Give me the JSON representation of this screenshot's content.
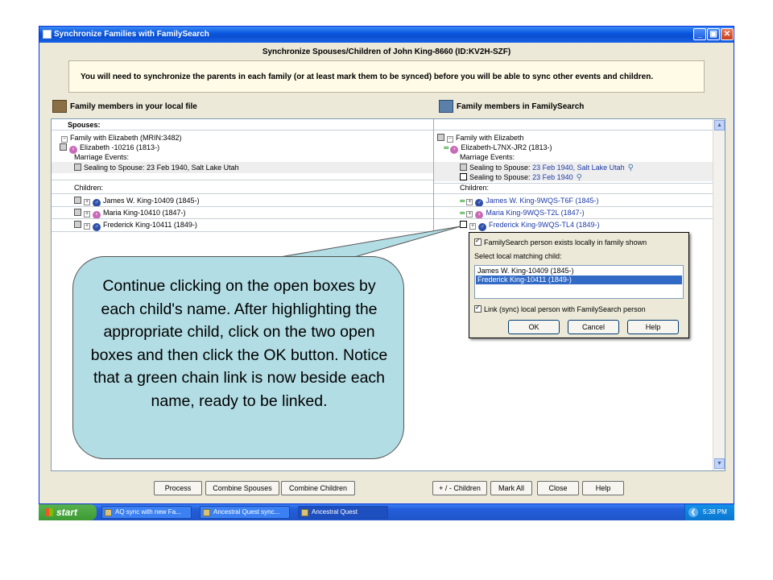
{
  "window": {
    "title": "Synchronize Families with FamilySearch",
    "dialog_title": "Synchronize Spouses/Children of John King-8660   (ID:KV2H-SZF)",
    "message": "You will need to synchronize the parents in each family (or at least mark them to be synced) before you will be able to sync other events and children."
  },
  "panes": {
    "local_header": "Family members in your local file",
    "fs_header": "Family members in FamilySearch",
    "spouses_label": "Spouses:"
  },
  "local": {
    "family": "Family with Elizabeth (MRIN:3482)",
    "spouse": "Elizabeth -10216 (1813-)",
    "marriage_label": "Marriage Events:",
    "sealing": "Sealing to Spouse: 23 Feb 1940, Salt Lake Utah",
    "children_label": "Children:",
    "children": [
      "James W. King-10409 (1845-)",
      "Maria King-10410 (1847-)",
      "Frederick King-10411 (1849-)"
    ]
  },
  "familysearch": {
    "family": "Family with Elizabeth",
    "spouse": "Elizabeth-L7NX-JR2 (1813-)",
    "marriage_label": "Marriage Events:",
    "sealing1_prefix": "Sealing to Spouse: ",
    "sealing1_value": "23 Feb 1940, Salt Lake Utah",
    "sealing2_prefix": "Sealing to Spouse: ",
    "sealing2_value": "23 Feb 1940",
    "children_label": "Children:",
    "children": [
      "James W. King-9WQS-T6F (1845-)",
      "Maria King-9WQS-T2L (1847-)",
      "Frederick King-9WQS-TL4 (1849-)"
    ]
  },
  "popup": {
    "exists_label": "FamilySearch person exists locally in family shown",
    "select_label": "Select local matching child:",
    "options": [
      "James W. King-10409 (1845-)",
      "Frederick King-10411 (1849-)"
    ],
    "selected_index": 1,
    "link_label": "Link (sync) local person with FamilySearch person",
    "ok": "OK",
    "cancel": "Cancel",
    "help": "Help"
  },
  "buttons": {
    "process": "Process",
    "combine_spouses": "Combine Spouses",
    "combine_children": "Combine Children",
    "plus_minus_children": "+ / - Children",
    "mark_all": "Mark All",
    "close": "Close",
    "help": "Help"
  },
  "taskbar": {
    "start": "start",
    "tasks": [
      "AQ sync with new Fa...",
      "Ancestral Quest sync...",
      "Ancestral Quest"
    ],
    "clock": "5:38 PM"
  },
  "callout": {
    "text": "Continue clicking on the open boxes by each child's name.  After highlighting the appropriate child, click on the two open boxes and then click the OK button.  Notice that a green chain link is now beside each name, ready to be linked."
  },
  "colors": {
    "title_blue": "#0a58e0",
    "link_blue": "#1c3aa8",
    "chain_green": "#1a9a1a",
    "selection_blue": "#316ac5",
    "callout_fill": "#b2dde4",
    "taskbar_start_green": "#3c9a33"
  }
}
